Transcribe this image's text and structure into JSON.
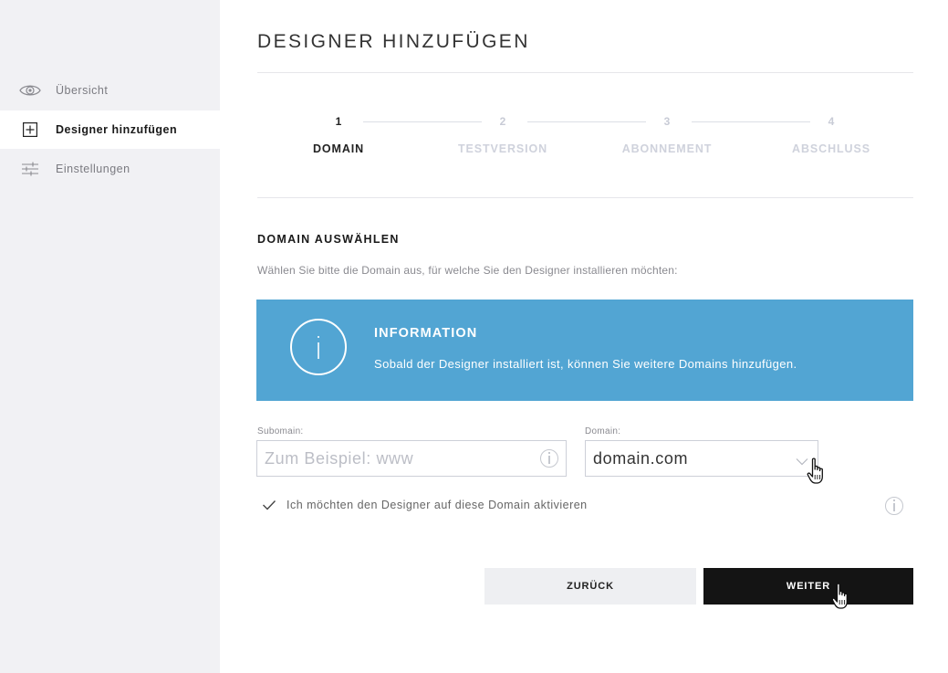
{
  "sidebar": {
    "items": [
      {
        "label": "Übersicht",
        "icon": "eye-icon",
        "active": false
      },
      {
        "label": "Designer hinzufügen",
        "icon": "plus-square-icon",
        "active": true
      },
      {
        "label": "Einstellungen",
        "icon": "sliders-icon",
        "active": false
      }
    ]
  },
  "page": {
    "title": "DESIGNER HINZUFÜGEN"
  },
  "steps": [
    {
      "number": "1",
      "label": "DOMAIN",
      "active": true
    },
    {
      "number": "2",
      "label": "TESTVERSION",
      "active": false
    },
    {
      "number": "3",
      "label": "ABONNEMENT",
      "active": false
    },
    {
      "number": "4",
      "label": "ABSCHLUSS",
      "active": false
    }
  ],
  "section": {
    "title": "DOMAIN AUSWÄHLEN",
    "description": "Wählen Sie bitte die Domain aus, für welche Sie den Designer installieren möchten:"
  },
  "info": {
    "title": "INFORMATION",
    "text": "Sobald der Designer installiert ist, können Sie weitere Domains hinzufügen.",
    "color": "#52a5d3"
  },
  "form": {
    "subdomain": {
      "label": "Subomain:",
      "placeholder": "Zum Beispiel: www",
      "value": ""
    },
    "domain": {
      "label": "Domain:",
      "value": "domain.com"
    },
    "activate": {
      "label": "Ich möchten den Designer auf diese Domain aktivieren",
      "checked": true
    }
  },
  "buttons": {
    "back": "ZURÜCK",
    "next": "WEITER"
  },
  "colors": {
    "sidebar_bg": "#f1f1f4",
    "primary_button": "#141414",
    "secondary_button": "#eeeff2"
  }
}
